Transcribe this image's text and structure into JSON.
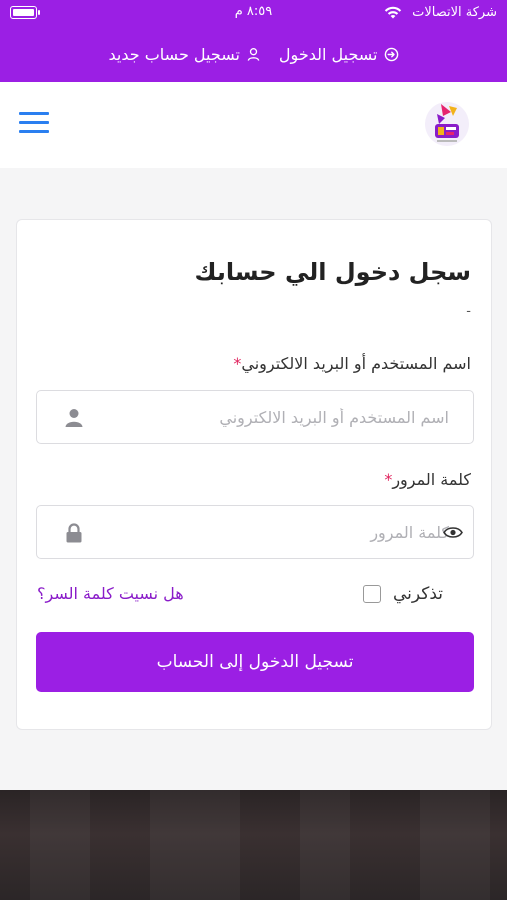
{
  "status": {
    "carrier": "شركة الاتصالات",
    "time": "٨:٥٩ م"
  },
  "topbar": {
    "login_label": "تسجيل الدخول",
    "register_label": "تسجيل حساب جديد"
  },
  "header": {
    "menu_icon": "hamburger-menu-icon",
    "logo_icon": "brand-logo"
  },
  "login_form": {
    "title": "سجل دخول الي حسابك",
    "subtitle": "-",
    "username": {
      "label": "اسم المستخدم أو البريد الالكتروني",
      "required_mark": "*",
      "placeholder": "اسم المستخدم أو البريد الالكتروني",
      "value": ""
    },
    "password": {
      "label": "كلمة المرور",
      "required_mark": "*",
      "placeholder": "كلمة المرور",
      "value": ""
    },
    "remember_label": "تذكرني",
    "remember_checked": false,
    "forgot_label": "هل نسيت كلمة السر؟",
    "submit_label": "تسجيل الدخول إلى الحساب"
  },
  "colors": {
    "primary": "#9b1fe4",
    "link": "#8a1cc9",
    "menu": "#2a7ff0",
    "required": "#e0245e"
  }
}
